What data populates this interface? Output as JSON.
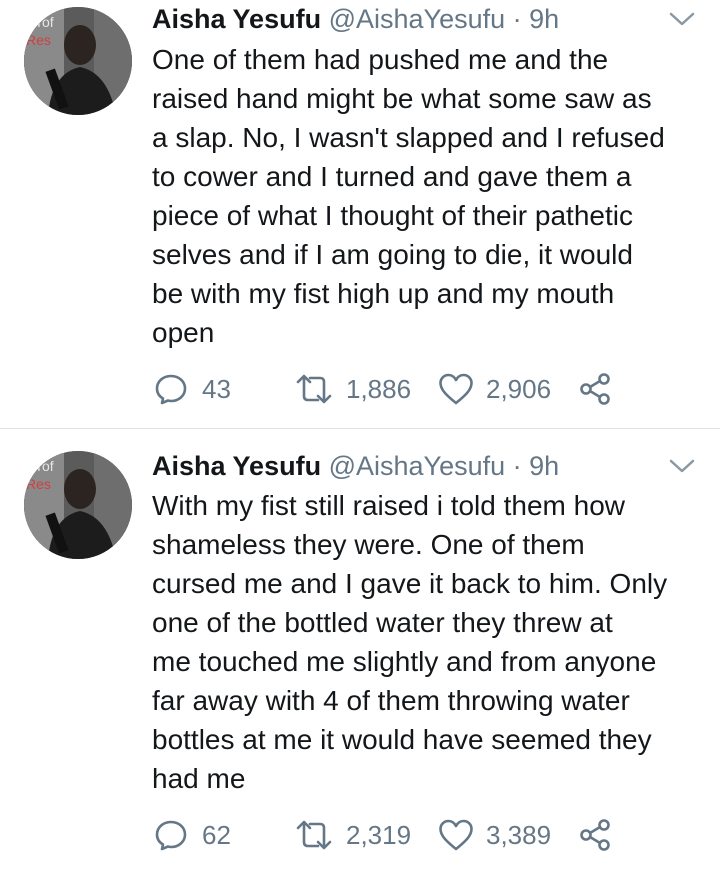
{
  "tweets": [
    {
      "name": "Aisha Yesufu",
      "handle": "@AishaYesufu",
      "separator": "·",
      "time": "9h",
      "text": "One of them had pushed me and the\nraised hand might be what some saw as\na slap. No, I wasn't slapped and I refused\nto cower and I turned and gave them a\npiece of what I thought of their pathetic\nselves and if I am going to die, it would\nbe with my fist high up and my mouth\nopen",
      "replies": "43",
      "retweets": "1,886",
      "likes": "2,906"
    },
    {
      "name": "Aisha Yesufu",
      "handle": "@AishaYesufu",
      "separator": "·",
      "time": "9h",
      "text": "With my fist still raised i told them how\nshameless they were. One of them\ncursed me and I gave it back to him. Only\none of the bottled water they threw at\nme touched me slightly and from anyone\nfar away with 4 of them throwing water\nbottles at me it would have seemed they\nhad me",
      "replies": "62",
      "retweets": "2,319",
      "likes": "3,389"
    }
  ],
  "colors": {
    "text": "#14171a",
    "muted": "#657786",
    "divider": "#dfe3e6"
  },
  "icons": [
    "reply-icon",
    "retweet-icon",
    "like-icon",
    "share-icon",
    "chevron-down-icon"
  ]
}
